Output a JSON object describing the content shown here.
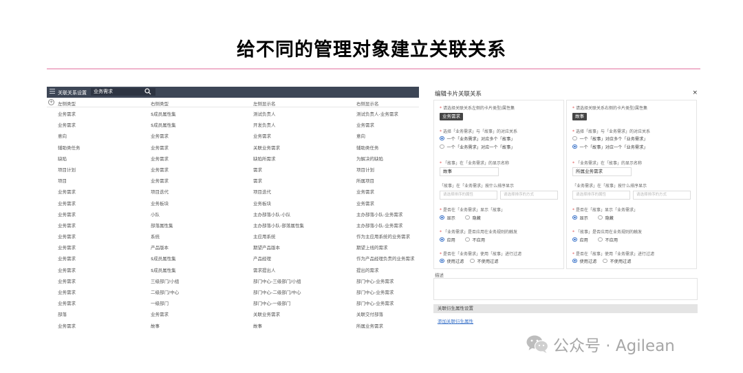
{
  "title": "给不同的管理对象建立关联关系",
  "left_panel": {
    "bar_label": "关联关系设置",
    "search_value": "业务需求",
    "columns": [
      "左侧类型",
      "右侧类型",
      "左侧显示名",
      "右侧显示名"
    ],
    "rows": [
      [
        "业务需求",
        "$成员属性集",
        "测试负责人",
        "测试负责人-业务需求"
      ],
      [
        "业务需求",
        "$成员属性集",
        "开发负责人",
        "业务需求"
      ],
      [
        "意向",
        "业务需求",
        "业务需求",
        "意向"
      ],
      [
        "辅助类任务",
        "业务需求",
        "关联业务需求",
        "辅助类任务"
      ],
      [
        "缺陷",
        "业务需求",
        "缺陷所需求",
        "为解决的缺陷"
      ],
      [
        "项目计划",
        "业务需求",
        "需求",
        "项目计划"
      ],
      [
        "项目",
        "业务需求",
        "需求",
        "所属项目"
      ],
      [
        "业务需求",
        "项目迭代",
        "项目迭代",
        "业务需求"
      ],
      [
        "业务需求",
        "业务板块",
        "业务板块",
        "业务需求"
      ],
      [
        "业务需求",
        "小队",
        "主办部落小队-小队",
        "主办部落小队-业务需求"
      ],
      [
        "业务需求",
        "部落属性集",
        "主办部落小队-部落属性集",
        "主办部落小队-业务需求"
      ],
      [
        "业务需求",
        "系统",
        "主应用系统",
        "作为主应用系统的业务需求"
      ],
      [
        "业务需求",
        "产品版本",
        "期望产品版本",
        "期望上线的需求"
      ],
      [
        "业务需求",
        "$成员属性集",
        "产品经理",
        "作为产品经理负责的业务需求"
      ],
      [
        "业务需求",
        "$成员属性集",
        "需求提出人",
        "提出的需求"
      ],
      [
        "业务需求",
        "三级部门/小组",
        "部门中心-三级部门/小组",
        "部门中心-业务需求"
      ],
      [
        "业务需求",
        "二级部门/中心",
        "部门中心-二级部门/中心",
        "部门中心-业务需求"
      ],
      [
        "业务需求",
        "一级部门",
        "部门中心-一级部门",
        "部门中心-业务需求"
      ],
      [
        "部落",
        "业务需求",
        "关联业务需求",
        "关联交付部落"
      ],
      [
        "业务需求",
        "故事",
        "故事",
        "所属业务需求"
      ]
    ]
  },
  "dialog": {
    "title": "编辑卡片关联关系",
    "close": "×",
    "left_card": {
      "type_label": "请选择关联关系左侧的卡片类型/属性集",
      "type_value": "业务需求",
      "relation_label": "选择「业务需求」与「故事」的对应关系",
      "relation_options": [
        "一个「业务需求」对应多个「故事」",
        "一个「业务需求」对应一个「故事」"
      ],
      "display_label": "「故事」在「业务需求」的显示名称",
      "display_value": "故事",
      "sort_label": "「故事」在「业务需求」按什么排序显示",
      "sort_placeholders": [
        "请选择排序的属性",
        "请选择排序的方式"
      ],
      "show_label": "是否在「业务需求」显示「故事」",
      "show_options": [
        "显示",
        "隐藏"
      ],
      "trigger_label": "「业务需求」是否应用在业务规则的触发",
      "trigger_options": [
        "应用",
        "不应用"
      ],
      "filter_label": "是否在「业务需求」使用「故事」进行过滤",
      "filter_options": [
        "使用过滤",
        "不使用过滤"
      ]
    },
    "right_card": {
      "type_label": "请选择关联关系右侧的卡片类型/属性集",
      "type_value": "故事",
      "relation_label": "选择「故事」与「业务需求」的对应关系",
      "relation_options": [
        "一个「故事」对应多个「业务需求」",
        "一个「故事」对应一个「业务需求」"
      ],
      "display_label": "「业务需求」在「故事」的显示名称",
      "display_value": "所属业务需求",
      "sort_label": "「业务需求」在「故事」按什么排序显示",
      "sort_placeholders": [
        "请选择排序的属性",
        "请选择排序的方式"
      ],
      "show_label": "是否在「故事」显示「业务需求」",
      "show_options": [
        "显示",
        "隐藏"
      ],
      "trigger_label": "「故事」是否应用在业务规则的触发",
      "trigger_options": [
        "应用",
        "不应用"
      ],
      "filter_label": "是否在「故事」使用「业务需求」进行过滤",
      "filter_options": [
        "使用过滤",
        "不使用过滤"
      ]
    },
    "description_label": "描述",
    "section_title": "关联衍生属性设置",
    "add_link": "添加关联衍生属性"
  },
  "watermark": "公众号 · Agilean",
  "colors": {
    "bar": "#3d4656",
    "accent": "#3b73c9",
    "divider": "#f0b3cc",
    "required": "#e05050"
  }
}
